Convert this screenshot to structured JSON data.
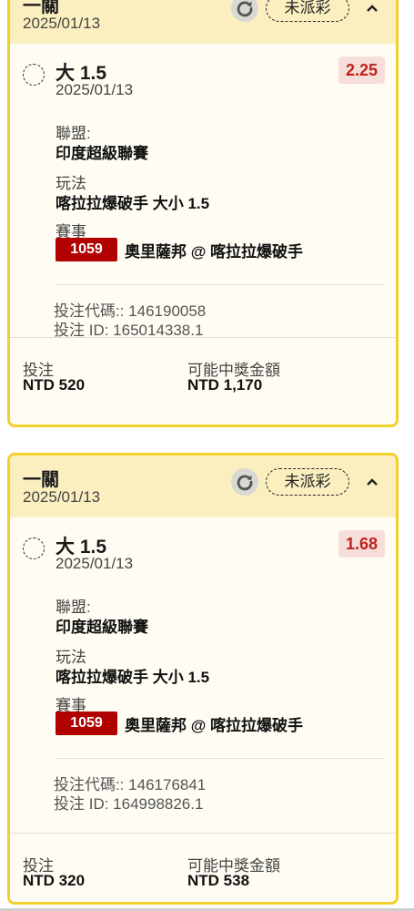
{
  "bets": [
    {
      "type": "一關",
      "date": "2025/01/13",
      "status": "未派彩",
      "selection": {
        "name": "大 1.5",
        "date": "2025/01/13",
        "odds": "2.25"
      },
      "league_label": "聯盟:",
      "league": "印度超級聯賽",
      "market_label": "玩法",
      "market": "喀拉拉爆破手 大小 1.5",
      "event_label": "賽事",
      "event_id": "1059",
      "event_name": "奧里薩邦 @ 喀拉拉爆破手",
      "bet_code": "投注代碼:: 146190058",
      "bet_id": "投注 ID: 165014338.1",
      "stake_label": "投注",
      "stake": "NTD 520",
      "payout_label": "可能中獎金額",
      "payout": "NTD 1,170"
    },
    {
      "type": "一關",
      "date": "2025/01/13",
      "status": "未派彩",
      "selection": {
        "name": "大 1.5",
        "date": "2025/01/13",
        "odds": "1.68"
      },
      "league_label": "聯盟:",
      "league": "印度超級聯賽",
      "market_label": "玩法",
      "market": "喀拉拉爆破手 大小 1.5",
      "event_label": "賽事",
      "event_id": "1059",
      "event_name": "奧里薩邦 @ 喀拉拉爆破手",
      "bet_code": "投注代碼:: 146176841",
      "bet_id": "投注 ID: 164998826.1",
      "stake_label": "投注",
      "stake": "NTD 320",
      "payout_label": "可能中獎金額",
      "payout": "NTD 538"
    }
  ],
  "colors": {
    "border": "#f2d02e",
    "header_bg": "#fbefc0",
    "odds_text": "#c0221b",
    "event_badge": "#b00000"
  },
  "icons": {
    "refresh": "refresh-icon",
    "collapse": "chevron-up-icon",
    "selection": "dashed-circle-icon"
  }
}
